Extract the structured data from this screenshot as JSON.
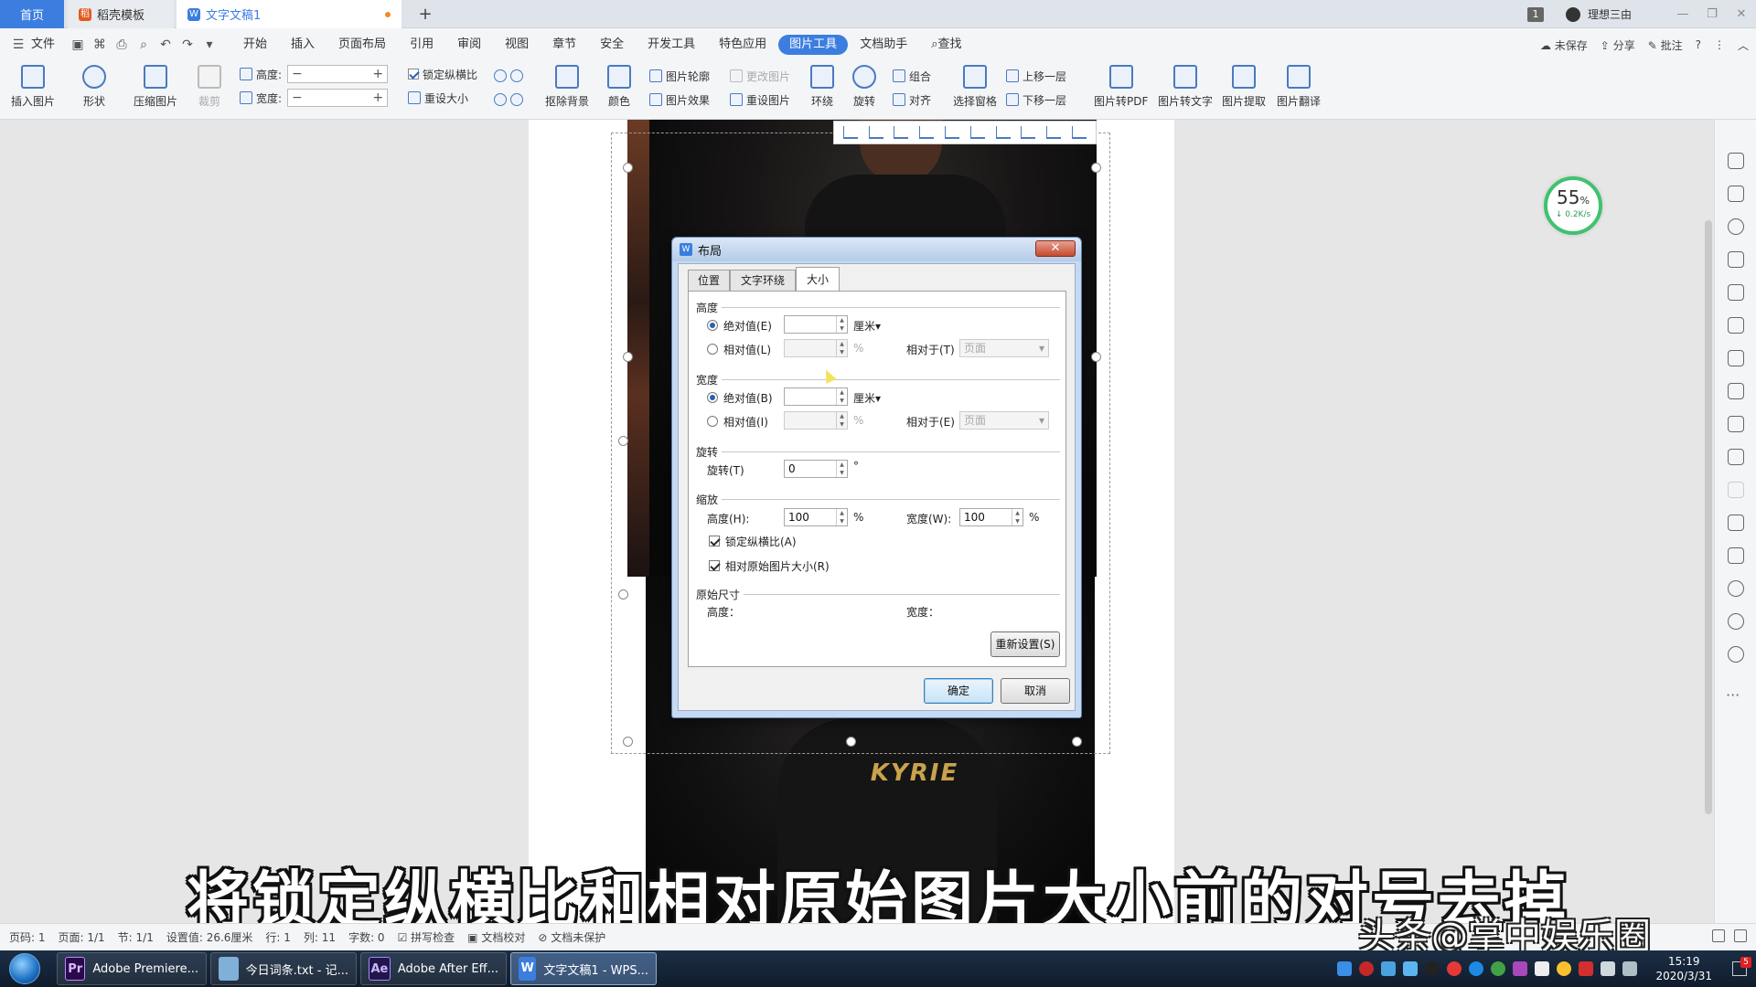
{
  "tabs": {
    "home": "首页",
    "template": "稻壳模板",
    "document": "文字文稿1",
    "add": "+"
  },
  "titlebar": {
    "window_count": "1",
    "user_name": "理想三由"
  },
  "menu": {
    "file": "文件",
    "items": [
      "开始",
      "插入",
      "页面布局",
      "引用",
      "审阅",
      "视图",
      "章节",
      "安全",
      "开发工具",
      "特色应用",
      "图片工具",
      "文档助手"
    ],
    "active_index": 10,
    "search": "查找",
    "unsaved": "未保存",
    "share": "分享",
    "comment": "批注",
    "help": "?"
  },
  "ribbon": {
    "insert_picture": "插入图片",
    "shape": "形状",
    "compress_picture": "压缩图片",
    "crop": "裁剪",
    "height_label": "高度:",
    "width_label": "宽度:",
    "lock_ratio": "锁定纵横比",
    "reset_size": "重设大小",
    "remove_background": "抠除背景",
    "color": "颜色",
    "picture_outline": "图片轮廓",
    "picture_effect": "图片效果",
    "change_picture": "更改图片",
    "reset_picture": "重设图片",
    "wrap": "环绕",
    "rotate": "旋转",
    "group": "组合",
    "align": "对齐",
    "bring_forward": "上移一层",
    "send_backward": "下移一层",
    "selection_pane": "选择窗格",
    "to_pdf": "图片转PDF",
    "to_text": "图片转文字",
    "extract": "图片提取",
    "translate": "图片翻译"
  },
  "speed_widget": {
    "percent": "55",
    "unit": "%",
    "rate": "↓ 0.2K/s"
  },
  "photo": {
    "shirt_text": "KYRIE"
  },
  "dialog": {
    "title": "布局",
    "tabs": [
      "位置",
      "文字环绕",
      "大小"
    ],
    "active_tab": 2,
    "height": {
      "section": "高度",
      "absolute_label": "绝对值(E)",
      "absolute_value": "",
      "absolute_unit": "厘米",
      "relative_label": "相对值(L)",
      "relative_value": "",
      "relative_unit": "%",
      "relative_to_label": "相对于(T)",
      "relative_to_value": "页面",
      "selected": "absolute"
    },
    "width": {
      "section": "宽度",
      "absolute_label": "绝对值(B)",
      "absolute_value": "",
      "absolute_unit": "厘米",
      "relative_label": "相对值(I)",
      "relative_value": "",
      "relative_unit": "%",
      "relative_to_label": "相对于(E)",
      "relative_to_value": "页面",
      "selected": "absolute"
    },
    "rotation": {
      "section": "旋转",
      "label": "旋转(T)",
      "value": "0",
      "unit": "°"
    },
    "scale": {
      "section": "缩放",
      "height_label": "高度(H):",
      "height_value": "100",
      "height_unit": "%",
      "width_label": "宽度(W):",
      "width_value": "100",
      "width_unit": "%",
      "lock_ratio_label": "锁定纵横比(A)",
      "lock_ratio_checked": true,
      "relative_original_label": "相对原始图片大小(R)",
      "relative_original_checked": true
    },
    "original": {
      "section": "原始尺寸",
      "height_label": "高度：",
      "width_label": "宽度："
    },
    "reset_button": "重新设置(S)",
    "ok_button": "确定",
    "cancel_button": "取消"
  },
  "caption": "将锁定纵横比和相对原始图片大小前的对号去掉",
  "watermark": "头条@掌中娱乐圈",
  "statusbar": {
    "page_code": "页码: 1",
    "page": "页面: 1/1",
    "section": "节: 1/1",
    "setting": "设置值: 26.6厘米",
    "row": "行: 1",
    "col": "列: 11",
    "word_count": "字数: 0",
    "spell_check": "拼写检查",
    "doc_proof": "文档校对",
    "doc_protect": "文档未保护"
  },
  "taskbar": {
    "apps": [
      {
        "icon": "Pr",
        "label": "Adobe Premiere...",
        "color": "#2a0a4a"
      },
      {
        "icon": "",
        "label": "今日词条.txt - 记...",
        "color": "#7fb0d8"
      },
      {
        "icon": "Ae",
        "label": "Adobe After Eff...",
        "color": "#23154a"
      },
      {
        "icon": "W",
        "label": "文字文稿1 - WPS...",
        "color": "#3b7ee0"
      }
    ],
    "active_index": 3,
    "time": "15:19",
    "date": "2020/3/31",
    "notify_count": "5"
  }
}
